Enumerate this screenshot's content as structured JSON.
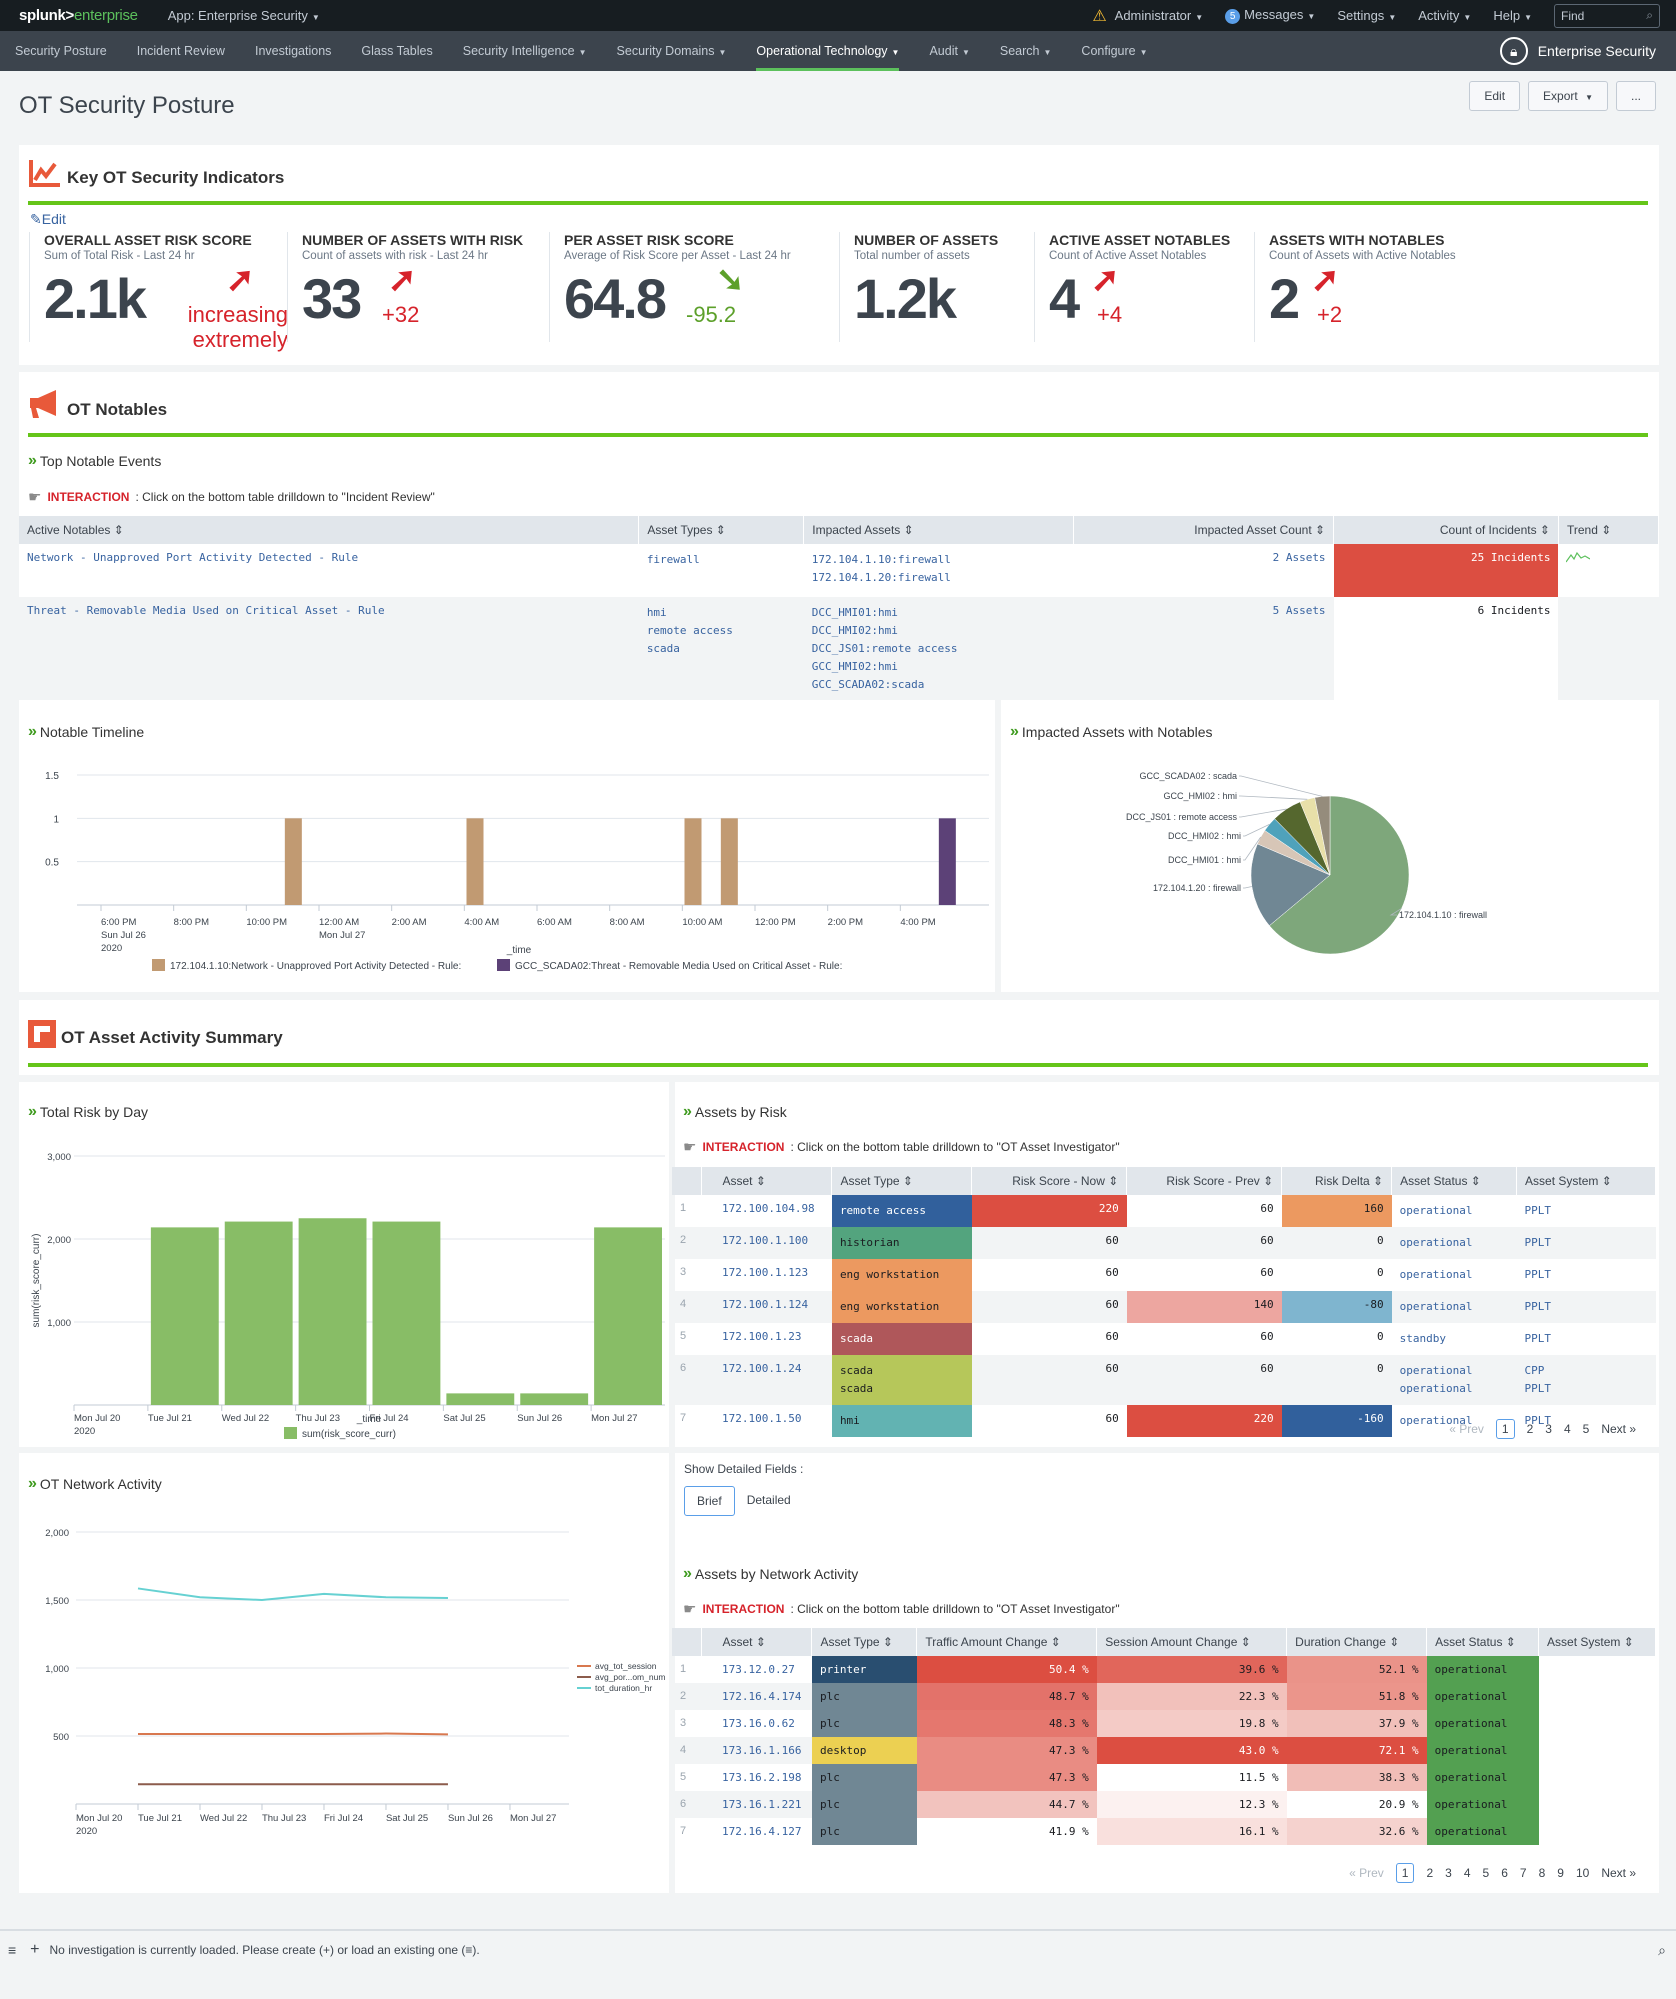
{
  "topbar": {
    "logo_main": "splunk>",
    "logo_ent": "enterprise",
    "app": "App: Enterprise Security",
    "items": [
      "Administrator",
      "Messages",
      "Settings",
      "Activity",
      "Help"
    ],
    "messages_count": "5",
    "find_placeholder": "Find"
  },
  "nav": {
    "items": [
      {
        "label": "Security Posture",
        "caret": false
      },
      {
        "label": "Incident Review",
        "caret": false
      },
      {
        "label": "Investigations",
        "caret": false
      },
      {
        "label": "Glass Tables",
        "caret": false
      },
      {
        "label": "Security Intelligence",
        "caret": true
      },
      {
        "label": "Security Domains",
        "caret": true
      },
      {
        "label": "Operational Technology",
        "caret": true,
        "active": true
      },
      {
        "label": "Audit",
        "caret": true
      },
      {
        "label": "Search",
        "caret": true
      },
      {
        "label": "Configure",
        "caret": true
      }
    ],
    "brand": "Enterprise Security"
  },
  "page": {
    "title": "OT Security Posture",
    "edit": "Edit",
    "export": "Export",
    "more": "..."
  },
  "kpi_section": {
    "title": "Key OT Security Indicators",
    "edit_link": "Edit",
    "kpis": [
      {
        "title": "OVERALL ASSET RISK SCORE",
        "subtitle": "Sum of Total Risk - Last 24 hr",
        "value": "2.1k",
        "trend": "up",
        "delta": "increasing extremely"
      },
      {
        "title": "NUMBER OF ASSETS WITH RISK",
        "subtitle": "Count of assets with risk - Last 24 hr",
        "value": "33",
        "trend": "up",
        "delta": "+32"
      },
      {
        "title": "PER ASSET RISK SCORE",
        "subtitle": "Average of Risk Score per Asset - Last 24 hr",
        "value": "64.8",
        "trend": "down",
        "delta": "-95.2"
      },
      {
        "title": "NUMBER OF ASSETS",
        "subtitle": "Total number of assets",
        "value": "1.2k",
        "trend": "none",
        "delta": ""
      },
      {
        "title": "ACTIVE ASSET NOTABLES",
        "subtitle": "Count of Active Asset Notables",
        "value": "4",
        "trend": "up",
        "delta": "+4"
      },
      {
        "title": "ASSETS WITH NOTABLES",
        "subtitle": "Count of Assets with Active Notables",
        "value": "2",
        "trend": "up",
        "delta": "+2"
      }
    ]
  },
  "notables_section": {
    "title": "OT Notables",
    "subtitle": "Top Notable Events",
    "interaction_label": "INTERACTION",
    "interaction_text": ": Click on the bottom table drilldown to \"Incident Review\"",
    "columns": [
      "Active Notables",
      "Asset Types",
      "Impacted Assets",
      "Impacted Asset Count",
      "Count of Incidents",
      "Trend"
    ],
    "rows": [
      {
        "notable": "Network - Unapproved Port Activity Detected - Rule",
        "types": [
          "firewall"
        ],
        "assets": [
          "172.104.1.10:firewall",
          "172.104.1.20:firewall"
        ],
        "count": "2 Assets",
        "incidents": "25 Incidents",
        "incidents_color": "#dc4e41",
        "trend": true
      },
      {
        "notable": "Threat - Removable Media Used on Critical Asset - Rule",
        "types": [
          "hmi",
          "remote access",
          "scada"
        ],
        "assets": [
          "DCC_HMI01:hmi",
          "DCC_HMI02:hmi",
          "DCC_JS01:remote access",
          "GCC_HMI02:hmi",
          "GCC_SCADA02:scada"
        ],
        "count": "5 Assets",
        "incidents": "6 Incidents",
        "incidents_color": "#ffffff",
        "trend": false
      }
    ]
  },
  "timeline": {
    "title": "Notable Timeline"
  },
  "pie": {
    "title": "Impacted Assets with Notables"
  },
  "activity_section": {
    "title": "OT Asset Activity Summary"
  },
  "risk_by_day": {
    "title": "Total Risk by Day"
  },
  "network_activity": {
    "title": "OT Network Activity"
  },
  "assets_by_risk": {
    "title": "Assets by Risk",
    "interaction_label": "INTERACTION",
    "interaction_text": ": Click on the bottom table drilldown to \"OT Asset Investigator\"",
    "columns": [
      "",
      "Asset",
      "Asset Type",
      "Risk Score - Now",
      "Risk Score - Prev",
      "Risk Delta",
      "Asset Status",
      "Asset System"
    ],
    "rows": [
      {
        "n": "1",
        "asset": "172.100.104.98",
        "type": [
          "remote access"
        ],
        "type_color": "#31609c",
        "now": "220",
        "now_color": "#dc4e41",
        "prev": "60",
        "prev_color": "",
        "delta": "160",
        "delta_color": "#ec9960",
        "status": [
          "operational"
        ],
        "system": [
          "PPLT"
        ]
      },
      {
        "n": "2",
        "asset": "172.100.1.100",
        "type": [
          "historian"
        ],
        "type_color": "#53a47e",
        "now": "60",
        "now_color": "",
        "prev": "60",
        "prev_color": "",
        "delta": "0",
        "delta_color": "",
        "status": [
          "operational"
        ],
        "system": [
          "PPLT"
        ]
      },
      {
        "n": "3",
        "asset": "172.100.1.123",
        "type": [
          "eng workstation"
        ],
        "type_color": "#ec9960",
        "now": "60",
        "now_color": "",
        "prev": "60",
        "prev_color": "",
        "delta": "0",
        "delta_color": "",
        "status": [
          "operational"
        ],
        "system": [
          "PPLT"
        ]
      },
      {
        "n": "4",
        "asset": "172.100.1.124",
        "type": [
          "eng workstation"
        ],
        "type_color": "#ec9960",
        "now": "60",
        "now_color": "",
        "prev": "140",
        "prev_color": "#eda6a0",
        "delta": "-80",
        "delta_color": "#7fb5cf",
        "status": [
          "operational"
        ],
        "system": [
          "PPLT"
        ]
      },
      {
        "n": "5",
        "asset": "172.100.1.23",
        "type": [
          "scada"
        ],
        "type_color": "#af575a",
        "now": "60",
        "now_color": "",
        "prev": "60",
        "prev_color": "",
        "delta": "0",
        "delta_color": "",
        "status": [
          "standby"
        ],
        "system": [
          "PPLT"
        ]
      },
      {
        "n": "6",
        "asset": "172.100.1.24",
        "type": [
          "scada",
          "scada"
        ],
        "type_color": "#b6c75a",
        "now": "60",
        "now_color": "",
        "prev": "60",
        "prev_color": "",
        "delta": "0",
        "delta_color": "",
        "status": [
          "operational",
          "operational"
        ],
        "system": [
          "CPP",
          "PPLT"
        ]
      },
      {
        "n": "7",
        "asset": "172.100.1.50",
        "type": [
          "hmi"
        ],
        "type_color": "#62b3b2",
        "now": "60",
        "now_color": "",
        "prev": "220",
        "prev_color": "#dc4e41",
        "delta": "-160",
        "delta_color": "#31609c",
        "status": [
          "operational"
        ],
        "system": [
          "PPLT"
        ]
      }
    ],
    "pager": {
      "prev": "« Prev",
      "pages": [
        "1",
        "2",
        "3",
        "4",
        "5"
      ],
      "current": "1",
      "next": "Next »"
    }
  },
  "detail_toggle": {
    "label": "Show Detailed Fields :",
    "options": [
      "Brief",
      "Detailed"
    ],
    "selected": "Brief"
  },
  "assets_by_network": {
    "title": "Assets by Network Activity",
    "interaction_label": "INTERACTION",
    "interaction_text": ": Click on the bottom table drilldown to \"OT Asset Investigator\"",
    "columns": [
      "",
      "Asset",
      "Asset Type",
      "Traffic Amount Change",
      "Session Amount Change",
      "Duration Change",
      "Asset Status",
      "Asset System"
    ],
    "rows": [
      {
        "n": "1",
        "asset": "173.12.0.27",
        "type": "printer",
        "type_color": "#294e70",
        "traffic": "50.4 %",
        "traffic_color": "#dc4e41",
        "session": "39.6 %",
        "session_color": "#e1665b",
        "duration": "52.1 %",
        "duration_color": "#ea9389",
        "status": "operational",
        "system": ""
      },
      {
        "n": "2",
        "asset": "172.16.4.174",
        "type": "plc",
        "type_color": "#708794",
        "traffic": "48.7 %",
        "traffic_color": "#e3726a",
        "session": "22.3 %",
        "session_color": "#f2c1bb",
        "duration": "51.8 %",
        "duration_color": "#eb958b",
        "status": "operational",
        "system": ""
      },
      {
        "n": "3",
        "asset": "173.16.0.62",
        "type": "plc",
        "type_color": "#708794",
        "traffic": "48.3 %",
        "traffic_color": "#e5776e",
        "session": "19.8 %",
        "session_color": "#f4cbc6",
        "duration": "37.9 %",
        "duration_color": "#f1c0ba",
        "status": "operational",
        "system": ""
      },
      {
        "n": "4",
        "asset": "173.16.1.166",
        "type": "desktop",
        "type_color": "#ecd052",
        "traffic": "47.3 %",
        "traffic_color": "#e98c83",
        "session": "43.0 %",
        "session_color": "#dc4e41",
        "duration": "72.1 %",
        "duration_color": "#dc4e41",
        "status": "operational",
        "system": ""
      },
      {
        "n": "5",
        "asset": "173.16.2.198",
        "type": "plc",
        "type_color": "#708794",
        "traffic": "47.3 %",
        "traffic_color": "#e98c83",
        "session": "11.5 %",
        "session_color": "#ffffff",
        "duration": "38.3 %",
        "duration_color": "#f1bdb7",
        "status": "operational",
        "system": ""
      },
      {
        "n": "6",
        "asset": "173.16.1.221",
        "type": "plc",
        "type_color": "#708794",
        "traffic": "44.7 %",
        "traffic_color": "#f2c3be",
        "session": "12.3 %",
        "session_color": "#fcf1f0",
        "duration": "20.9 %",
        "duration_color": "#ffffff",
        "status": "operational",
        "system": ""
      },
      {
        "n": "7",
        "asset": "172.16.4.127",
        "type": "plc",
        "type_color": "#708794",
        "traffic": "41.9 %",
        "traffic_color": "#ffffff",
        "session": "16.1 %",
        "session_color": "#f9e0dd",
        "duration": "32.6 %",
        "duration_color": "#f5d2ce",
        "status": "operational",
        "system": ""
      }
    ],
    "status_color": "#53a051",
    "pager": {
      "prev": "« Prev",
      "pages": [
        "1",
        "2",
        "3",
        "4",
        "5",
        "6",
        "7",
        "8",
        "9",
        "10"
      ],
      "current": "1",
      "next": "Next »"
    }
  },
  "bottom_bar": {
    "text": "No investigation is currently loaded. Please create (+) or load an existing one (≡)."
  },
  "chart_data": [
    {
      "id": "notable_timeline",
      "type": "bar",
      "title": "Notable Timeline",
      "xlabel": "_time",
      "ylabel": "",
      "ylim": [
        0,
        1.5
      ],
      "yticks": [
        "0.5",
        "1",
        "1.5"
      ],
      "xticks": [
        "6:00 PM\nSun Jul 26\n2020",
        "8:00 PM",
        "10:00 PM",
        "12:00 AM\nMon Jul 27",
        "2:00 AM",
        "4:00 AM",
        "6:00 AM",
        "8:00 AM",
        "10:00 AM",
        "12:00 PM",
        "2:00 PM",
        "4:00 PM"
      ],
      "x_hours_range": [
        0,
        24
      ],
      "series": [
        {
          "name": "172.104.1.10:Network - Unapproved Port Activity Detected - Rule:",
          "color": "#c19a72",
          "points": [
            {
              "hour": 5.5,
              "value": 1
            },
            {
              "hour": 10.5,
              "value": 1
            },
            {
              "hour": 16.5,
              "value": 1
            },
            {
              "hour": 17.5,
              "value": 1
            }
          ]
        },
        {
          "name": "GCC_SCADA02:Threat - Removable Media Used on Critical Asset - Rule:",
          "color": "#5c4177",
          "points": [
            {
              "hour": 23.5,
              "value": 1
            }
          ]
        }
      ],
      "legend": "bottom"
    },
    {
      "id": "impacted_assets_pie",
      "type": "pie",
      "title": "Impacted Assets with Notables",
      "labels": [
        "172.104.1.10 : firewall",
        "172.104.1.20 : firewall",
        "DCC_HMI01 : hmi",
        "DCC_HMI02 : hmi",
        "DCC_JS01 : remote access",
        "GCC_HMI02 : hmi",
        "GCC_SCADA02 : scada"
      ],
      "values": [
        62,
        17,
        3,
        3,
        6,
        3,
        3
      ],
      "colors": [
        "#7ea77b",
        "#708794",
        "#d7c6b7",
        "#4fa2bb",
        "#55672e",
        "#e8e0a9",
        "#958c7c"
      ]
    },
    {
      "id": "total_risk_by_day",
      "type": "bar",
      "title": "Total Risk by Day",
      "xlabel": "_time",
      "ylabel": "sum(risk_score_curr)",
      "ylim": [
        0,
        3000
      ],
      "yticks": [
        "1,000",
        "2,000",
        "3,000"
      ],
      "categories": [
        "Mon Jul 20\n2020",
        "Tue Jul 21",
        "Wed Jul 22",
        "Thu Jul 23",
        "Fri Jul 24",
        "Sat Jul 25",
        "Sun Jul 26",
        "Mon Jul 27"
      ],
      "series": [
        {
          "name": "sum(risk_score_curr)",
          "color": "#88bd66",
          "values": [
            0,
            2140,
            2210,
            2250,
            2210,
            140,
            140,
            2140
          ]
        }
      ],
      "legend": "bottom"
    },
    {
      "id": "ot_network_activity",
      "type": "line",
      "title": "OT Network Activity",
      "xlabel": "_time",
      "ylabel": "",
      "ylim": [
        0,
        2000
      ],
      "yticks": [
        "500",
        "1,000",
        "1,500",
        "2,000"
      ],
      "categories": [
        "Mon Jul 20\n2020",
        "Tue Jul 21",
        "Wed Jul 22",
        "Thu Jul 23",
        "Fri Jul 24",
        "Sat Jul 25",
        "Sun Jul 26",
        "Mon Jul 27"
      ],
      "series": [
        {
          "name": "avg_tot_session",
          "color": "#d8784f",
          "values": [
            null,
            515,
            515,
            515,
            515,
            518,
            512,
            null
          ]
        },
        {
          "name": "avg_por...om_num",
          "color": "#8c5c4c",
          "values": [
            null,
            145,
            145,
            145,
            145,
            145,
            145,
            null
          ]
        },
        {
          "name": "tot_duration_hr",
          "color": "#66d1d2",
          "values": [
            null,
            1585,
            1520,
            1500,
            1545,
            1520,
            1515,
            null
          ]
        }
      ],
      "legend": "right"
    }
  ]
}
